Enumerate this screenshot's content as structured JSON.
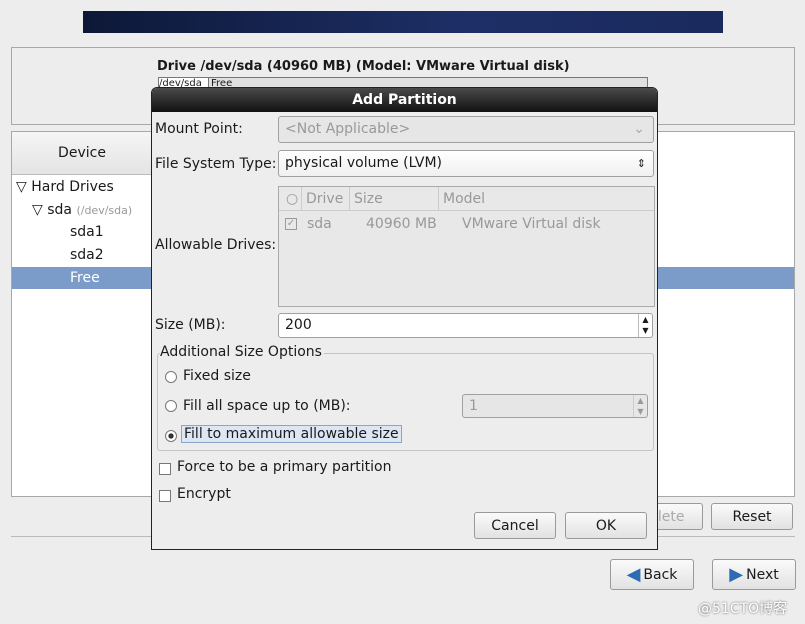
{
  "drive_label": "Drive /dev/sda (40960 MB) (Model: VMware Virtual disk)",
  "drive_bar": {
    "seg1": "/dev/sda",
    "seg2": "Free"
  },
  "tree": {
    "header": "Device",
    "items": [
      {
        "label": "Hard Drives"
      },
      {
        "label": "sda",
        "sub": "(/dev/sda)"
      },
      {
        "label": "sda1"
      },
      {
        "label": "sda2"
      },
      {
        "label": "Free"
      }
    ]
  },
  "buttons": {
    "delete": "Delete",
    "reset": "Reset",
    "back": "Back",
    "next": "Next"
  },
  "dialog": {
    "title": "Add Partition",
    "mount_point_label": "Mount Point:",
    "mount_point_value": "<Not Applicable>",
    "fs_type_label": "File System Type:",
    "fs_type_value": "physical volume (LVM)",
    "drives_label": "Allowable Drives:",
    "drives_columns": [
      "Drive",
      "Size",
      "Model"
    ],
    "drives_rows": [
      {
        "checked": true,
        "drive": "sda",
        "size": "40960 MB",
        "model": "VMware Virtual disk"
      }
    ],
    "size_label": "Size (MB):",
    "size_value": "200",
    "size_options_title": "Additional Size Options",
    "opt_fixed": "Fixed size",
    "opt_fill_upto": "Fill all space up to (MB):",
    "fill_upto_value": "1",
    "opt_fill_max": "Fill to maximum allowable size",
    "selected_option": "Fill to maximum allowable size",
    "primary_label": "Force to be a primary partition",
    "primary_checked": false,
    "encrypt_label": "Encrypt",
    "encrypt_checked": false,
    "cancel": "Cancel",
    "ok": "OK"
  },
  "watermark": "@51CTO博客",
  "colors": {
    "selection": "#7b9cc9",
    "title_bar": "#1e1e1e"
  }
}
